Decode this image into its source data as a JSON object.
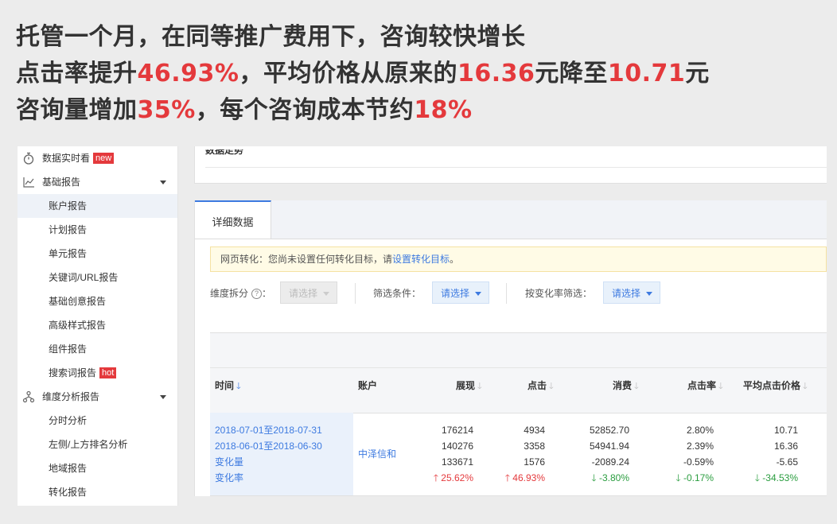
{
  "headline": {
    "line1": "托管一个月，在同等推广费用下，咨询较快增长",
    "line2": {
      "a": "点击率提升",
      "b": "46.93%",
      "c": "，平均价格从原来的",
      "d": "16.36",
      "e": "元降至",
      "f": "10.71",
      "g": "元"
    },
    "line3": {
      "a": "咨询量增加",
      "b": "35%",
      "c": "，每个咨询成本节约",
      "d": "18%"
    }
  },
  "colors": {
    "accent_red": "#e4393c",
    "link_blue": "#3d7ae0",
    "down_green": "#2a9d3f"
  },
  "sidebar": {
    "items": [
      {
        "label": "数据实时看",
        "icon": "stopwatch-icon",
        "tag": "new"
      },
      {
        "label": "基础报告",
        "icon": "line-chart-icon",
        "expanded": true
      },
      {
        "label": "账户报告",
        "active": true
      },
      {
        "label": "计划报告"
      },
      {
        "label": "单元报告"
      },
      {
        "label": "关键词/URL报告"
      },
      {
        "label": "基础创意报告"
      },
      {
        "label": "高级样式报告"
      },
      {
        "label": "组件报告"
      },
      {
        "label": "搜索词报告",
        "tag": "hot"
      },
      {
        "label": "维度分析报告",
        "icon": "hierarchy-icon",
        "expanded": true
      },
      {
        "label": "分时分析"
      },
      {
        "label": "左侧/上方排名分析"
      },
      {
        "label": "地域报告"
      },
      {
        "label": "转化报告"
      }
    ]
  },
  "trend": {
    "title": "数据走势"
  },
  "detail": {
    "tab": "详细数据",
    "notice": {
      "prefix": "网页转化：您尚未设置任何转化目标，请",
      "link": "设置转化目标",
      "suffix": "。"
    },
    "filters": {
      "dimension_label": "维度拆分",
      "dimension_colon": "：",
      "dimension_value": "请选择",
      "condition_label": "筛选条件：",
      "condition_value": "请选择",
      "rate_label": "按变化率筛选：",
      "rate_value": "请选择"
    }
  },
  "table": {
    "headers": {
      "time": "时间",
      "account": "账户",
      "impressions": "展现",
      "clicks": "点击",
      "cost": "消费",
      "ctr": "点击率",
      "avg_cpc": "平均点击价格"
    },
    "account": "中泽信和",
    "rows": [
      {
        "time": "2018-07-01至2018-07-31",
        "impressions": "176214",
        "clicks": "4934",
        "cost": "52852.70",
        "ctr": "2.80%",
        "avg_cpc": "10.71"
      },
      {
        "time": "2018-06-01至2018-06-30",
        "impressions": "140276",
        "clicks": "3358",
        "cost": "54941.94",
        "ctr": "2.39%",
        "avg_cpc": "16.36"
      },
      {
        "time": "变化量",
        "impressions": "133671",
        "clicks": "1576",
        "cost": "-2089.24",
        "ctr": "-0.59%",
        "avg_cpc": "-5.65"
      },
      {
        "time": "变化率",
        "impressions": "25.62%",
        "clicks": "46.93%",
        "cost": "-3.80%",
        "ctr": "-0.17%",
        "avg_cpc": "-34.53%"
      }
    ],
    "change_rate_direction": {
      "impressions": "up",
      "clicks": "up",
      "cost": "down",
      "ctr": "down",
      "avg_cpc": "down"
    }
  }
}
